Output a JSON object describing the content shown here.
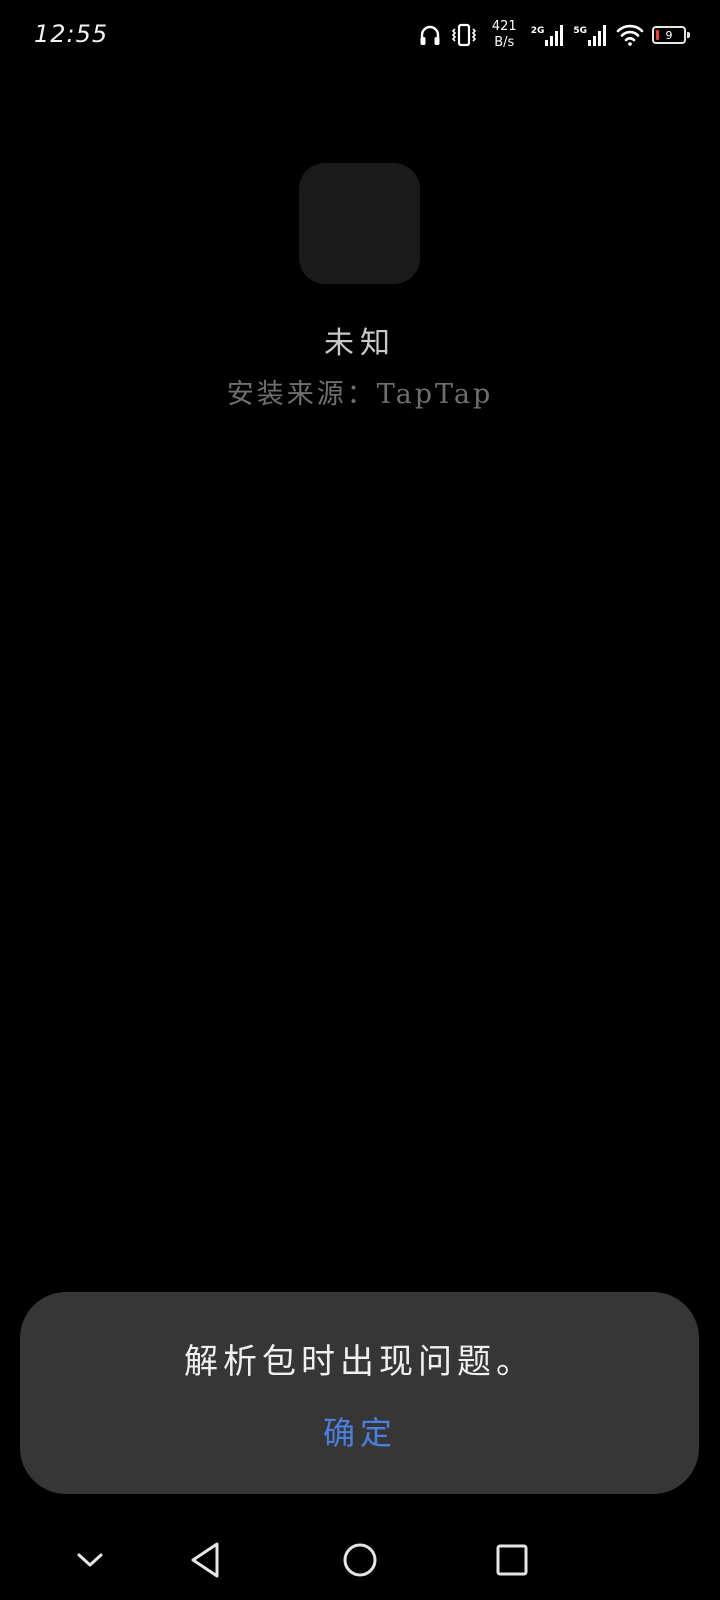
{
  "status_bar": {
    "time": "12:55",
    "net_speed_value": "421",
    "net_speed_unit": "B/s",
    "sim1_label": "2G",
    "sim2_label": "5G",
    "battery_level": "9",
    "icons": [
      "headphones-icon",
      "vibrate-icon",
      "signal-icon",
      "wifi-icon",
      "battery-icon"
    ],
    "battery_color": "#ff3b30"
  },
  "app": {
    "name": "未知",
    "install_source": "安装来源：TapTap"
  },
  "dialog": {
    "message": "解析包时出现问题。",
    "confirm_label": "确定",
    "confirm_color": "#4a7fe0"
  },
  "nav_bar": {
    "icons": [
      "chevron-down-icon",
      "back-icon",
      "home-icon",
      "recents-icon"
    ]
  }
}
